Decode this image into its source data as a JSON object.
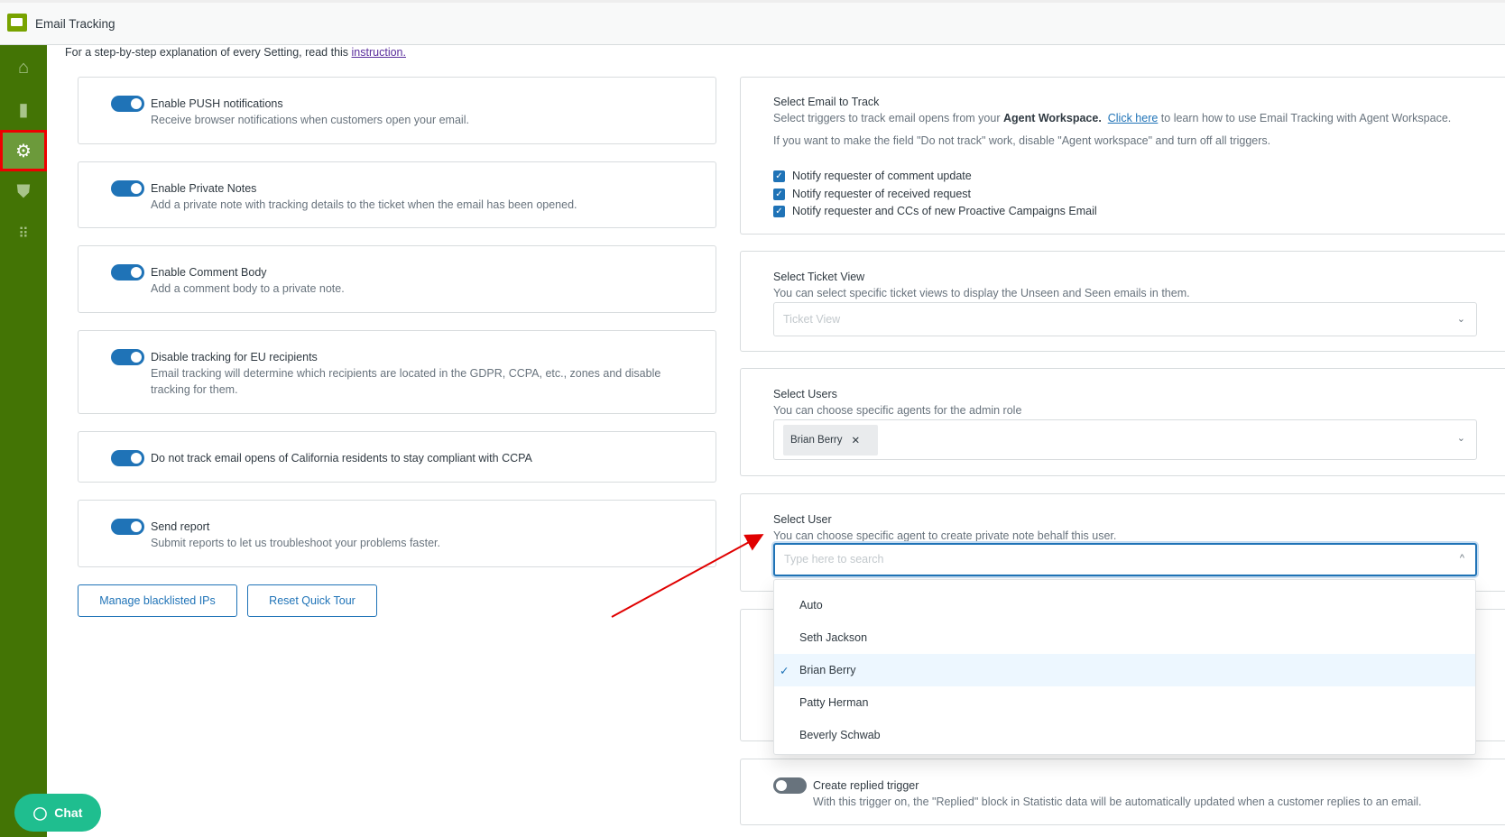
{
  "header": {
    "title": "Email Tracking"
  },
  "sidebar": {
    "items": [
      {
        "icon": "home-icon"
      },
      {
        "icon": "bar-chart-icon"
      },
      {
        "icon": "gear-icon",
        "active": true
      },
      {
        "icon": "shield-check-icon"
      },
      {
        "icon": "apps-grid-icon"
      }
    ]
  },
  "chat": {
    "label": "Chat"
  },
  "intro": {
    "text": "For a step-by-step explanation of every Setting, read this ",
    "link": "instruction."
  },
  "left_settings": [
    {
      "title": "Enable PUSH notifications",
      "desc": "Receive browser notifications when customers open your email.",
      "on": true
    },
    {
      "title": "Enable Private Notes",
      "desc": "Add a private note with tracking details to the ticket when the email has been opened.",
      "on": true
    },
    {
      "title": "Enable Comment Body",
      "desc": "Add a comment body to a private note.",
      "on": true
    },
    {
      "title": "Disable tracking for EU recipients",
      "desc": "Email tracking will determine which recipients are located in the GDPR, CCPA, etc., zones and disable tracking for them.",
      "on": true
    },
    {
      "title": "Do not track email opens of California residents to stay compliant with CCPA",
      "desc": "",
      "on": true
    },
    {
      "title": "Send report",
      "desc": "Submit reports to let us troubleshoot your problems faster.",
      "on": true
    }
  ],
  "buttons": {
    "blacklist": "Manage blacklisted IPs",
    "tour": "Reset Quick Tour"
  },
  "email_track": {
    "title": "Select Email to Track",
    "desc_pre": "Select triggers to track email opens from your ",
    "desc_bold": "Agent Workspace.",
    "link": "Click here",
    "desc_post": " to learn how to use Email Tracking with Agent Workspace.",
    "note": "If you want to make the field \"Do not track\" work, disable \"Agent workspace\" and turn off all triggers.",
    "checks": [
      "Notify requester of comment update",
      "Notify requester of received request",
      "Notify requester and CCs of new Proactive Campaigns Email"
    ]
  },
  "ticket_view": {
    "title": "Select Ticket View",
    "desc": "You can select specific ticket views to display the Unseen and Seen emails in them.",
    "placeholder": "Ticket View"
  },
  "users": {
    "title": "Select Users",
    "desc": "You can choose specific agents for the admin role",
    "tag": "Brian Berry"
  },
  "user": {
    "title": "Select User",
    "desc": "You can choose specific agent to create private note behalf this user.",
    "placeholder": "Type here to search",
    "options": [
      "Auto",
      "Seth Jackson",
      "Brian Berry",
      "Patty Herman",
      "Beverly Schwab"
    ],
    "selected": "Brian Berry"
  },
  "replied": {
    "title": "Create replied trigger",
    "desc": "With this trigger on, the \"Replied\" block in Statistic data will be automatically updated when a customer replies to an email.",
    "on": false
  },
  "colors": {
    "sidebar": "#437405",
    "accent": "#1f73b7",
    "chat": "#1fbe8f",
    "annotation": "#e00000"
  }
}
